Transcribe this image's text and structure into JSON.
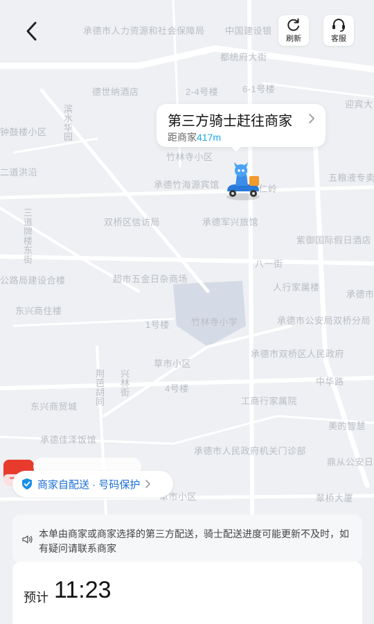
{
  "header": {
    "refresh_label": "刷新",
    "service_label": "客服"
  },
  "map": {
    "labels": [
      "承德市人力资源和社会保障局",
      "中国建设银",
      "都统府大街",
      "德世纳酒店",
      "2-4号楼",
      "6-1号楼",
      "迎宾大市",
      "滨水华园",
      "钟鼓楼小区",
      "竹林寺小区",
      "二道洪沿",
      "承德竹海源宾馆",
      "五粮液专卖",
      "广仁岭",
      "双桥区信访局",
      "承德军兴旅馆",
      "三道牌楼东街",
      "紫御国际假日酒店",
      "八一街",
      "公路局建设合楼",
      "超市五金日杂商场",
      "人行家属楼",
      "承德市局双桥",
      "东兴商住楼",
      "1号楼",
      "竹林寺小学",
      "承德市公安局双桥分局",
      "承德市双桥区人民政府",
      "草市小区",
      "荆芭胡同",
      "兴林街",
      "4号楼",
      "中华路",
      "东兴商贸城",
      "工商行家属院",
      "美的智慧",
      "承德佳泽饭馆",
      "承德市人民政府机关门诊部",
      "鼎从公安日西营庄",
      "草市小区",
      "翠桥大厦"
    ]
  },
  "rider_bubble": {
    "title": "第三方骑士赶往商家",
    "distance_prefix": "距商家",
    "distance_value": "417m"
  },
  "promo_badge": "招商局",
  "delivery_pill": {
    "label": "商家自配送 · 号码保护"
  },
  "notice": {
    "text": "本单由商家或商家选择的第三方配送，骑士配送进度可能更新不及时，如有疑问请联系商家"
  },
  "eta": {
    "prefix": "预计",
    "time": "11:23"
  },
  "colors": {
    "accent": "#1aa7e8",
    "pill_text": "#1a6fd6",
    "map_bg": "#eef0f3",
    "road": "#ffffff",
    "block": "#d4dbe6"
  }
}
